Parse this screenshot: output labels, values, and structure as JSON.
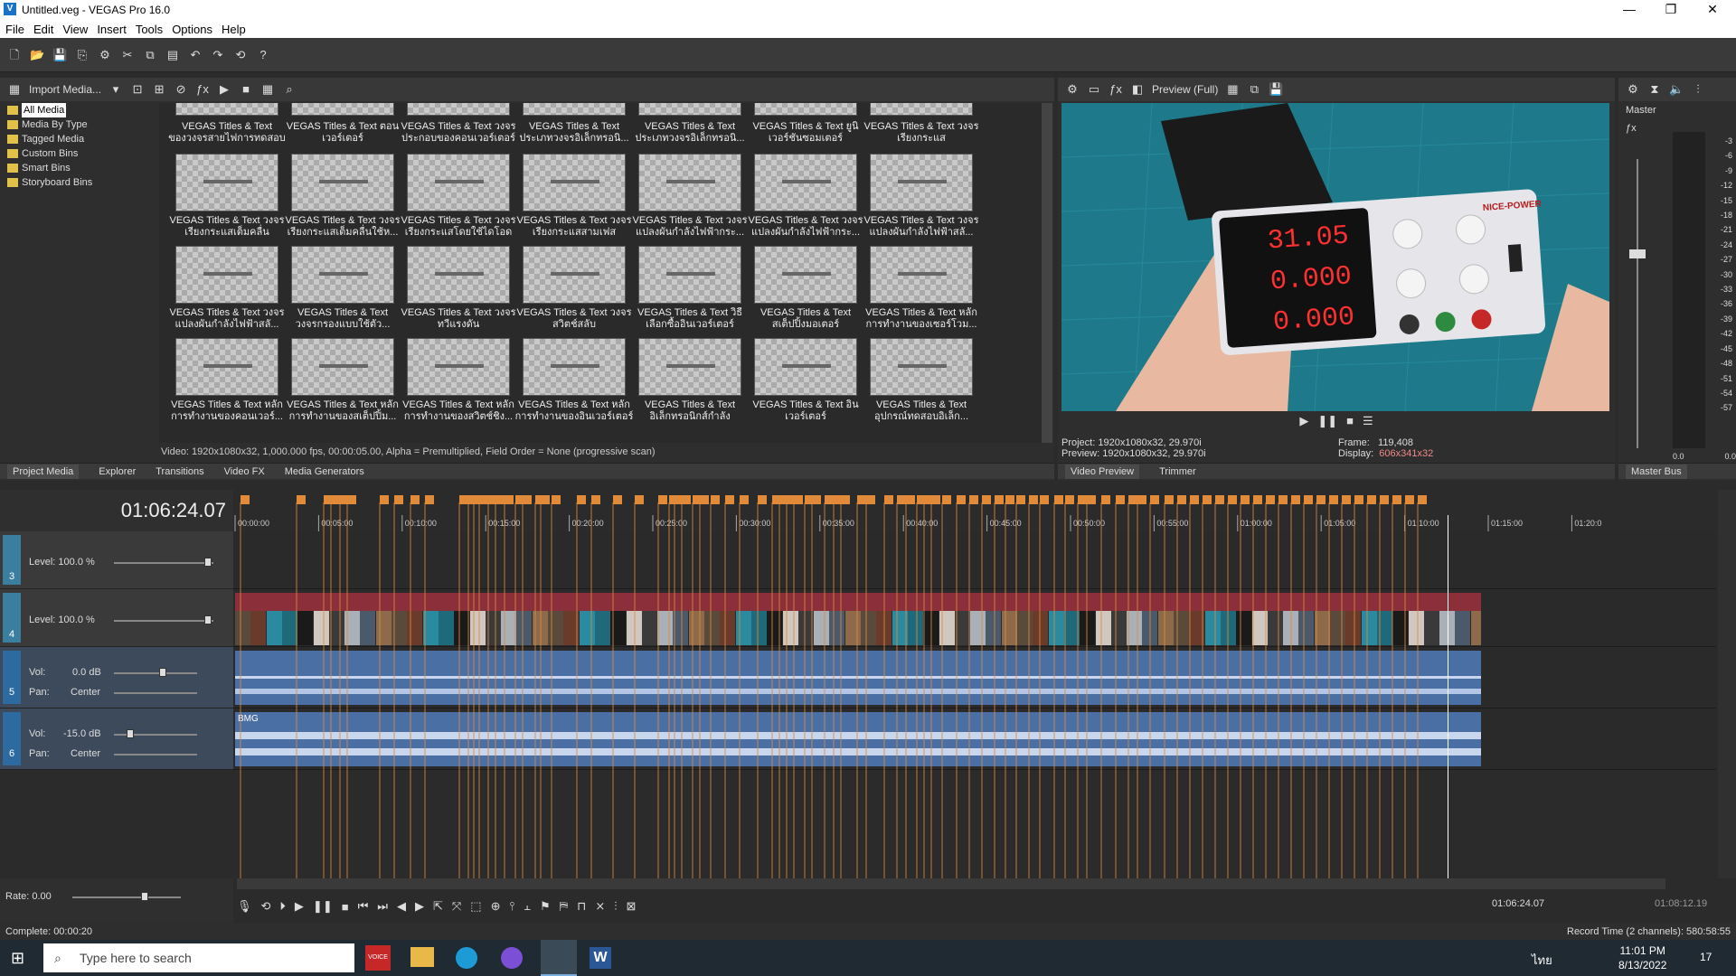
{
  "window": {
    "title": "Untitled.veg - VEGAS Pro 16.0"
  },
  "menu": [
    "File",
    "Edit",
    "View",
    "Insert",
    "Tools",
    "Options",
    "Help"
  ],
  "media": {
    "import_label": "Import Media...",
    "tree": [
      "All Media",
      "Media By Type",
      "Tagged Media",
      "Custom Bins",
      "Smart Bins",
      "Storyboard Bins"
    ],
    "rows": [
      [
        "VEGAS Titles & Text\nของวงจรสายไฟการทดสอบ",
        "VEGAS Titles & Text ตอน\nเวอร์เตอร์",
        "VEGAS Titles & Text วงจร\nประกอบของคอนเวอร์เตอร์",
        "VEGAS Titles & Text\nประเภทวงจรอิเล็กทรอนิ...",
        "VEGAS Titles & Text\nประเภทวงจรอิเล็กทรอนิ...",
        "VEGAS Titles & Text ยูนิ\nเวอร์ชันซอมเตอร์",
        "VEGAS Titles & Text วงจร\nเรียงกระแส"
      ],
      [
        "VEGAS Titles & Text วงจร\nเรียงกระแสเต็มคลื่น",
        "VEGAS Titles & Text วงจร\nเรียงกระแสเต็มคลื่นใช้ห...",
        "VEGAS Titles & Text วงจร\nเรียงกระแสโดยใช้ไดโอด",
        "VEGAS Titles & Text วงจร\nเรียงกระแสสามเฟส",
        "VEGAS Titles & Text วงจร\nแปลงผันกำลังไฟฟ้ากระ...",
        "VEGAS Titles & Text วงจร\nแปลงผันกำลังไฟฟ้ากระ...",
        "VEGAS Titles & Text วงจร\nแปลงผันกำลังไฟฟ้าสลั..."
      ],
      [
        "VEGAS Titles & Text วงจร\nแปลงผันกำลังไฟฟ้าสลั...",
        "VEGAS Titles & Text\nวงจรกรองแบบใช้ตัว...",
        "VEGAS Titles & Text วงจร\nทวีแรงดัน",
        "VEGAS Titles & Text วงจร\nสวิตช์สลับ",
        "VEGAS Titles & Text วิธี\nเลือกซื้ออินเวอร์เตอร์",
        "VEGAS Titles & Text\nสเต็ปปิ้งมอเตอร์",
        "VEGAS Titles & Text หลัก\nการทำงานของเซอร์โวม..."
      ],
      [
        "VEGAS Titles & Text หลัก\nการทำงานของคอนเวอร์...",
        "VEGAS Titles & Text หลัก\nการทำงานของสเต็ปปิ้ม...",
        "VEGAS Titles & Text หลัก\nการทำงานของสวิตช์ชิง...",
        "VEGAS Titles & Text หลัก\nการทำงานของอินเวอร์เตอร์",
        "VEGAS Titles & Text\nอิเล็กทรอนิกส์กำลัง",
        "VEGAS Titles & Text อิน\nเวอร์เตอร์",
        "VEGAS Titles & Text\nอุปกรณ์ทดสอบอิเล็ก..."
      ]
    ],
    "status": "Video: 1920x1080x32, 1,000.000 fps, 00:00:05.00, Alpha = Premultiplied, Field Order = None (progressive scan)",
    "tabs": [
      "Project Media",
      "Explorer",
      "Transitions",
      "Video FX",
      "Media Generators"
    ]
  },
  "preview": {
    "mode": "Preview (Full)",
    "project": "Project:  1920x1080x32, 29.970i",
    "preview": "Preview:  1920x1080x32, 29.970i",
    "frame_label": "Frame:",
    "frame": "119,408",
    "display_label": "Display:",
    "display": "606x341x32",
    "tabs": [
      "Video Preview",
      "Trimmer"
    ],
    "readout": [
      "31.05",
      "0.000",
      "0.000"
    ],
    "brand": "NICE-POWER"
  },
  "master": {
    "label": "Master",
    "scale": [
      "3",
      "6",
      "9",
      "12",
      "15",
      "18",
      "21",
      "24",
      "27",
      "30",
      "33",
      "36",
      "39",
      "42",
      "45",
      "48",
      "51",
      "54",
      "57"
    ],
    "foot": [
      "0.0",
      "0.0"
    ],
    "tab": "Master Bus"
  },
  "timeline": {
    "timecode": "01:06:24.07",
    "ruler": [
      "00:00:00",
      "00:05:00",
      "00:10:00",
      "00:15:00",
      "00:20:00",
      "00:25:00",
      "00:30:00",
      "00:35:00",
      "00:40:00",
      "00:45:00",
      "00:50:00",
      "00:55:00",
      "01:00:00",
      "01:05:00",
      "01:10:00",
      "01:15:00",
      "01:20:0"
    ],
    "tracks": [
      {
        "num": "3",
        "level": "Level: 100.0 %"
      },
      {
        "num": "4",
        "level": "Level: 100.0 %"
      },
      {
        "num": "5",
        "vol": "Vol:",
        "vol_val": "0.0 dB",
        "pan": "Pan:",
        "pan_val": "Center"
      },
      {
        "num": "6",
        "vol": "Vol:",
        "vol_val": "-15.0 dB",
        "pan": "Pan:",
        "pan_val": "Center",
        "clip": "BMG"
      }
    ],
    "rate": "Rate: 0.00",
    "cursor_time": "01:06:24.07",
    "end_time": "01:08:12.19"
  },
  "status": {
    "left": "Complete: 00:00:20",
    "right": "Record Time (2 channels): 580:58:55"
  },
  "taskbar": {
    "search_placeholder": "Type here to search",
    "time": "11:01 PM",
    "date": "8/13/2022",
    "lang": "ไทย",
    "notif": "17"
  }
}
